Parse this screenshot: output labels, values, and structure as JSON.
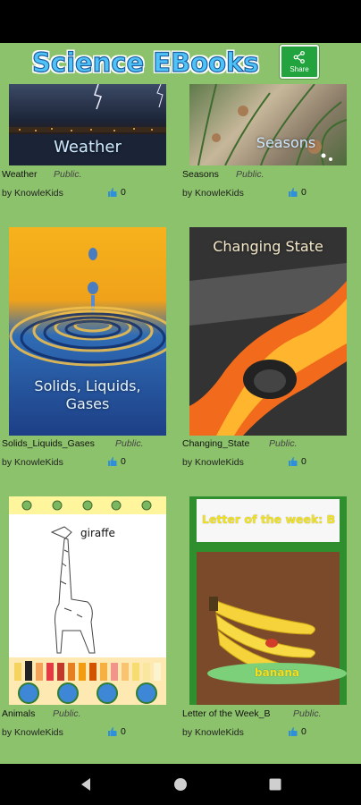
{
  "app": {
    "title": "Science EBooks",
    "share_label": "Share"
  },
  "books": [
    {
      "thumb_label": "Weather",
      "title": "Weather",
      "visibility": "Public.",
      "author": "by KnowleKids",
      "likes": "0"
    },
    {
      "thumb_label": "Seasons",
      "title": "Seasons",
      "visibility": "Public.",
      "author": "by KnowleKids",
      "likes": "0"
    },
    {
      "thumb_label": "Solids, Liquids, Gases",
      "title": "Solids_Liquids_Gases",
      "visibility": "Public.",
      "author": "by KnowleKids",
      "likes": "0"
    },
    {
      "thumb_label": "Changing State",
      "title": "Changing_State",
      "visibility": "Public.",
      "author": "by KnowleKids",
      "likes": "0"
    },
    {
      "thumb_label": "giraffe",
      "title": "Animals",
      "visibility": "Public.",
      "author": "by KnowleKids",
      "likes": "0"
    },
    {
      "thumb_label": "Letter of the week: B",
      "thumb_sublabel": "banana",
      "title": "Letter of the Week_B",
      "visibility": "Public.",
      "author": "by KnowleKids",
      "likes": "0"
    }
  ],
  "colors": {
    "background": "#8dc26c",
    "share": "#22a33d",
    "title_fill": "#4fc3f7"
  },
  "nav": {
    "back_icon": "back-triangle-icon",
    "home_icon": "home-circle-icon",
    "recents_icon": "recents-square-icon"
  }
}
